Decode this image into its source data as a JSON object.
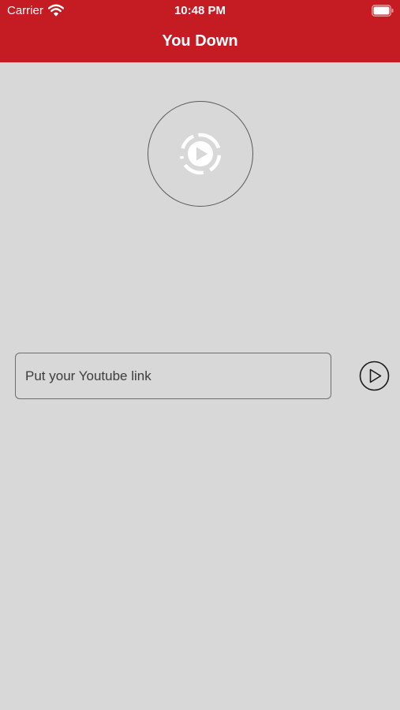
{
  "status_bar": {
    "carrier": "Carrier",
    "time": "10:48 PM",
    "wifi_icon": "wifi-icon",
    "battery_icon": "battery-icon"
  },
  "header": {
    "title": "You Down",
    "background_color": "#c41c22"
  },
  "logo": {
    "icon": "play-circle-icon"
  },
  "link_input": {
    "value": "",
    "placeholder": "Put your Youtube link"
  },
  "go_button": {
    "icon": "play-outline-icon"
  },
  "colors": {
    "accent": "#c41c22",
    "background": "#d8d8d8",
    "text": "#3c3c3c"
  }
}
